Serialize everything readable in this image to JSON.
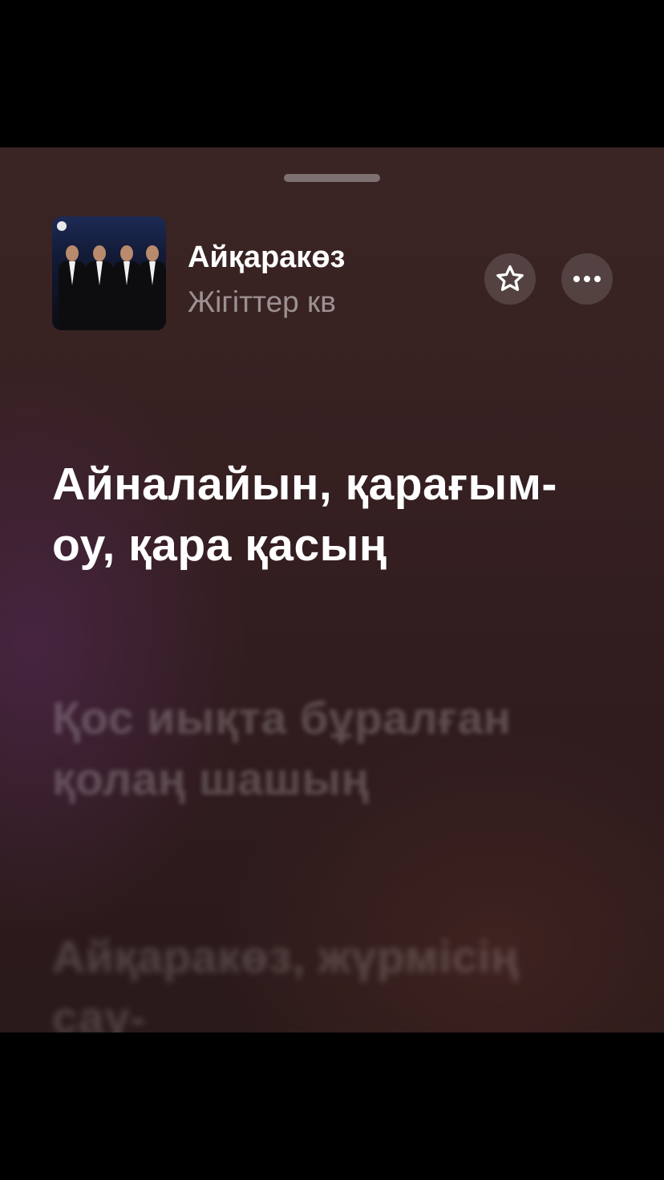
{
  "now_playing": {
    "song_title": "Айқаракөз",
    "artist": "Жігіттер кв"
  },
  "controls": {
    "favorite_icon": "star-icon",
    "more_icon": "ellipsis-icon"
  },
  "lyrics": {
    "current": "Айналайын, қарағым-оу, қара қасың",
    "next": "Қос иықта бұралған қолаң шашың",
    "after": "Айқаракөз, жүрмісің сау-"
  }
}
